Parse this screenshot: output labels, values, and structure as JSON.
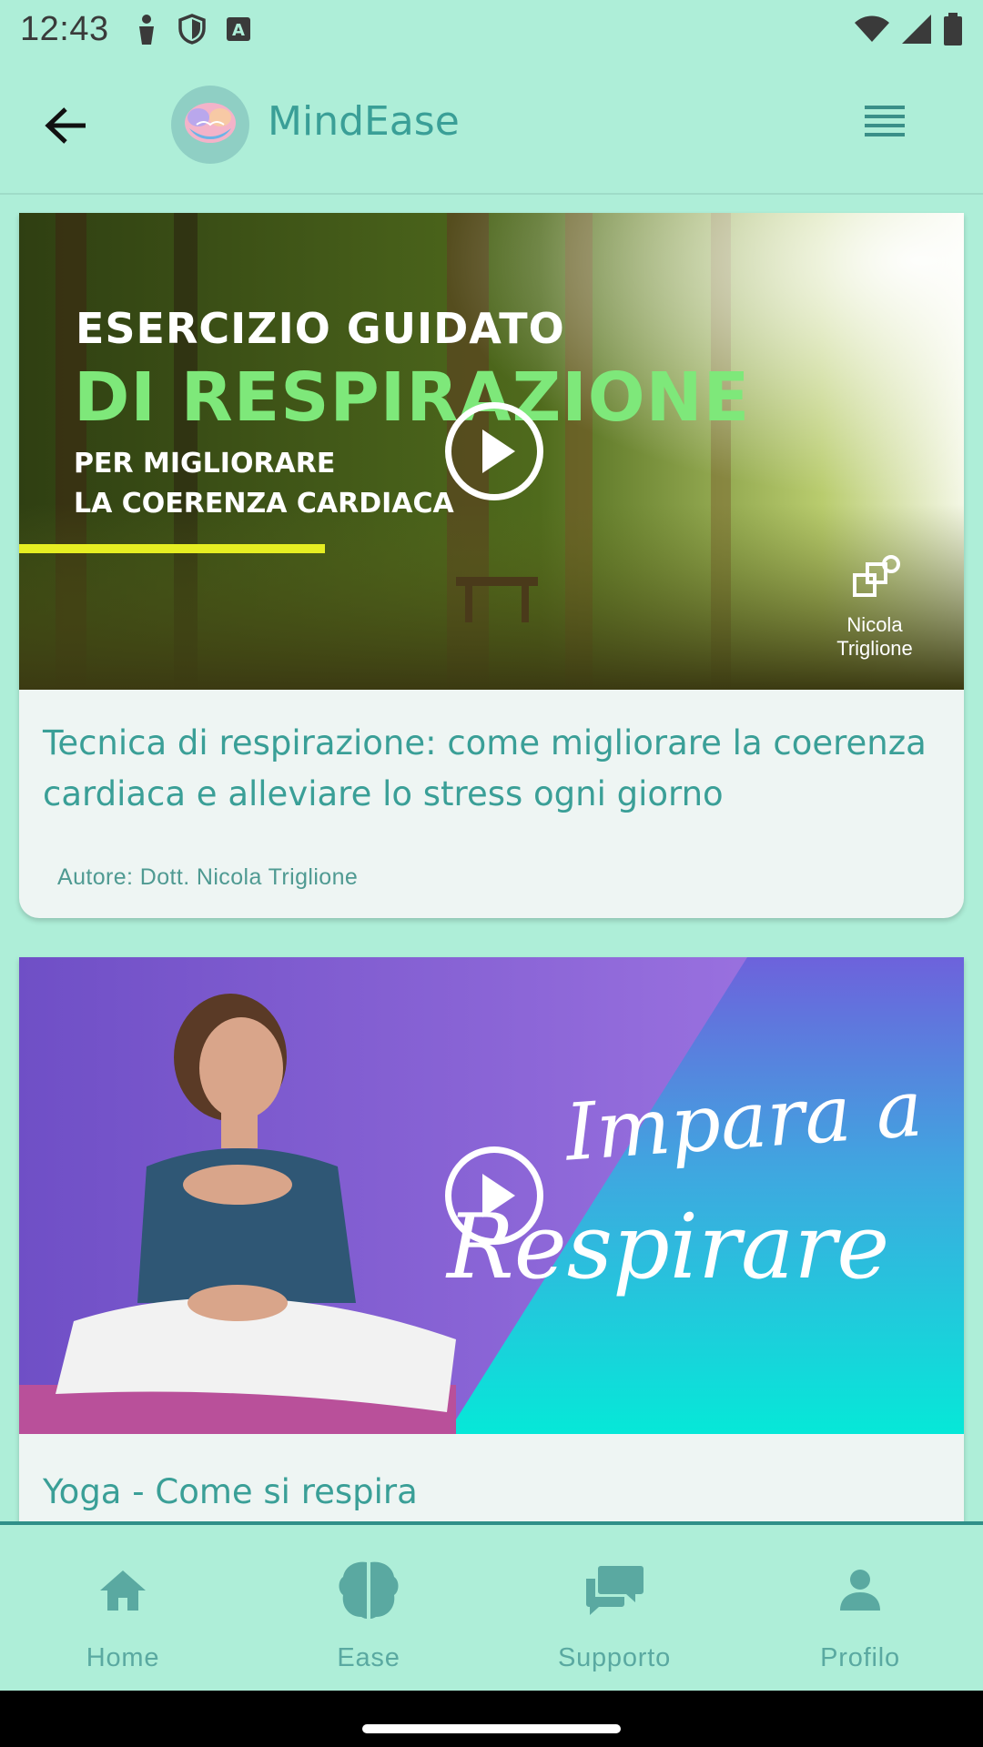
{
  "status_bar": {
    "time": "12:43"
  },
  "app_bar": {
    "title": "MindEase"
  },
  "cards": [
    {
      "thumbnail": {
        "line1": "ESERCIZIO GUIDATO",
        "line2": "DI RESPIRAZIONE",
        "line3": "PER MIGLIORARE",
        "line4": "LA COERENZA CARDIACA",
        "author": "Nicola\nTriglione"
      },
      "title": "Tecnica di respirazione: come migliorare la coerenza cardiaca e alleviare lo stress ogni giorno",
      "author": "Autore: Dott. Nicola Triglione"
    },
    {
      "thumbnail": {
        "line1": "Impara a",
        "line2": "Respirare"
      },
      "title": "Yoga - Come si respira"
    }
  ],
  "bottom_nav": [
    {
      "label": "Home",
      "icon": "home-icon"
    },
    {
      "label": "Ease",
      "icon": "brain-icon"
    },
    {
      "label": "Supporto",
      "icon": "chat-icon"
    },
    {
      "label": "Profilo",
      "icon": "person-icon"
    }
  ],
  "colors": {
    "background": "#aeeed8",
    "accent": "#3a9f97",
    "nav_label": "#5aa9a1"
  }
}
